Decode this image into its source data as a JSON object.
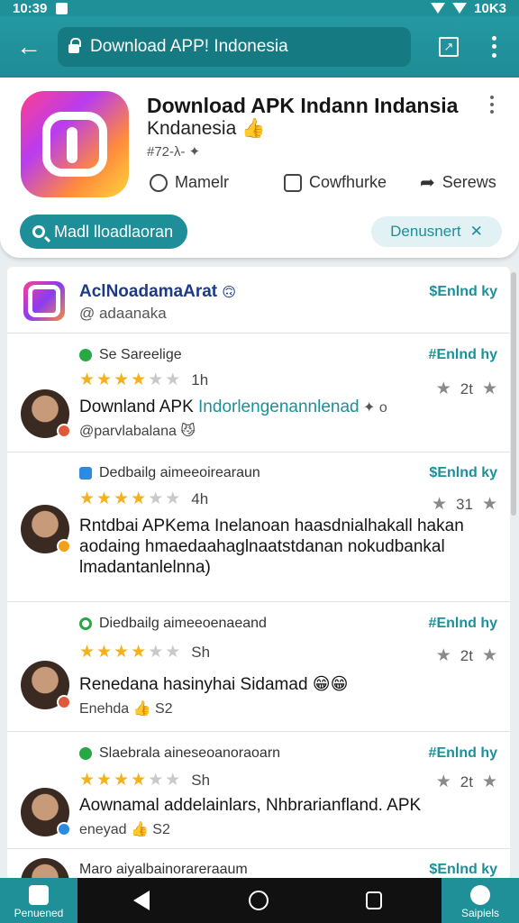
{
  "status_bar": {
    "time": "10:39",
    "right_text": "10K3"
  },
  "browser": {
    "url": "Download APP! Indonesia"
  },
  "app_card": {
    "title": "Download APK Indann Indansia",
    "subtitle": "Kndanesia 👍",
    "meta": "#72-λ- ✦",
    "actions": [
      {
        "label": "Mamelr",
        "icon": "chat-bubble-icon"
      },
      {
        "label": "Cowfhurke",
        "icon": "comment-icon"
      },
      {
        "label": "Serews",
        "icon": "share-icon"
      }
    ],
    "search_label": "Madl lloadlaoran",
    "filter_label": "Denusnert",
    "filter_icon": "✕"
  },
  "list_header": {
    "name": "AclNoadamaArat",
    "emoji": "🙃",
    "handle": "@ adaanaka",
    "follow": "$Enlnd ky"
  },
  "reviews": [
    {
      "category": "Se Sareelige",
      "rating": 4,
      "age": "1h",
      "votes": "2t",
      "follow": "#Enlnd hy",
      "text_main": "Downland APK ",
      "text_highlight": "Indorlengenannlenad",
      "text_tail": " ✦ o",
      "sub": "@parvlabalana  😼"
    },
    {
      "category": "Dedbailg aimeeoirearaun",
      "rating": 3.5,
      "age": "4h",
      "votes": "31",
      "follow": "$Enlnd ky",
      "text_main": "Rntdbai APKema Inelanoan haasdnialhakall hakan aodaing hmaedaahaglnaatstdanan nokudbankal lmadantanlelnna)"
    },
    {
      "category": "Diedbailg aimeeoenaeand",
      "rating": 3.5,
      "age": "Sh",
      "votes": "2t",
      "follow": "#Enlnd hy",
      "text_main": "Renedana hasinyhai Sidamad 😁😁",
      "sub": "Enehda 👍 S2"
    },
    {
      "category": "Slaebrala aineseoanoraoarn",
      "rating": 4,
      "age": "Sh",
      "votes": "2t",
      "follow": "#Enlnd hy",
      "text_main": "Aownamal addelainlars, Nhbrarianfland. APK",
      "sub": "eneyad 👍 S2"
    },
    {
      "category": "Maro aiyalbainorareraaum",
      "follow": "$Enlnd ky"
    }
  ],
  "nav": {
    "left_label": "Penuened",
    "right_label": "Saipiels"
  }
}
